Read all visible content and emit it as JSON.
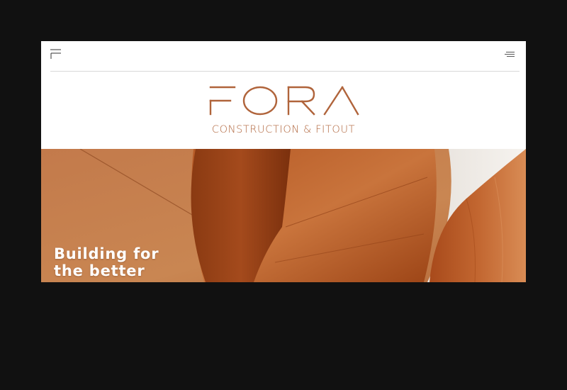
{
  "brand": {
    "name": "FORA",
    "tagline": "CONSTRUCTION & FITOUT",
    "color": "#b0643b"
  },
  "header": {
    "logo_mark_icon": "fora-monogram-icon",
    "menu_icon": "hamburger-menu-icon"
  },
  "hero": {
    "headline_line1": "Building for",
    "headline_line2": "the better",
    "image": "copper-curved-timber-architecture"
  }
}
